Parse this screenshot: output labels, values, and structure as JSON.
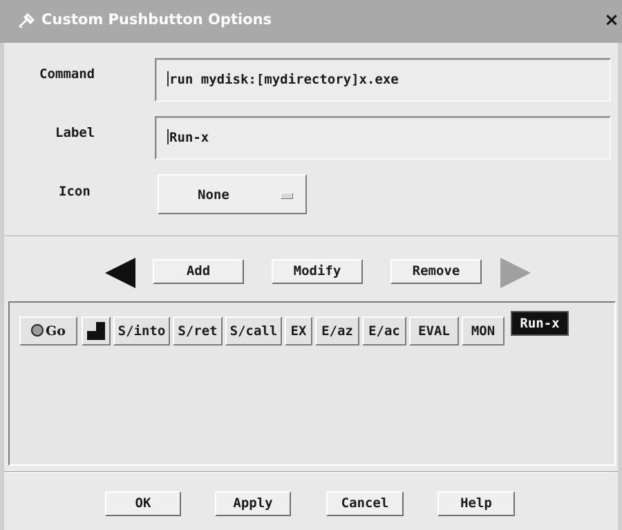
{
  "window": {
    "title": "Custom Pushbutton Options"
  },
  "form": {
    "command_label": "Command",
    "command_value": "run mydisk:[mydirectory]x.exe",
    "label_label": "Label",
    "label_value": "Run-x",
    "icon_label": "Icon",
    "icon_value": "None"
  },
  "edit_buttons": {
    "add": "Add",
    "modify": "Modify",
    "remove": "Remove"
  },
  "toolbar_preview": {
    "items": [
      "Go",
      "S/into",
      "S/ret",
      "S/call",
      "EX",
      "E/az",
      "E/ac",
      "EVAL",
      "MON",
      "Run-x"
    ],
    "selected": "Run-x"
  },
  "footer_buttons": {
    "ok": "OK",
    "apply": "Apply",
    "cancel": "Cancel",
    "help": "Help"
  },
  "icons": [
    "tool-icon",
    "close-icon",
    "left-arrow-icon",
    "right-arrow-icon",
    "stop-icon",
    "step-icon"
  ]
}
